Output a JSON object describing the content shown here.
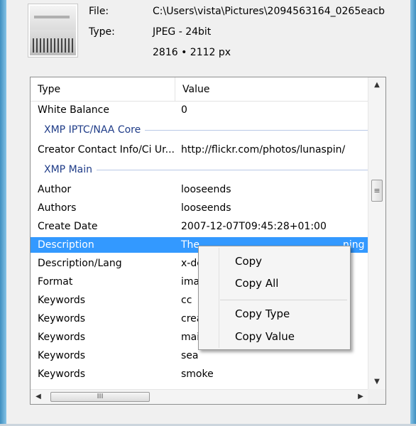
{
  "file_info": {
    "file_label": "File:",
    "file_value": "C:\\Users\\vista\\Pictures\\2094563164_0265eacb",
    "type_label": "Type:",
    "type_value": "JPEG - 24bit",
    "size_value": "2816 • 2112 px"
  },
  "table": {
    "columns": [
      "Type",
      "Value"
    ],
    "rows": [
      {
        "kind": "row",
        "type": "White Balance",
        "value": "0"
      },
      {
        "kind": "group",
        "title": "XMP IPTC/NAA Core"
      },
      {
        "kind": "row",
        "type": "Creator Contact Info/Ci Ur...",
        "value": "http://flickr.com/photos/lunaspin/"
      },
      {
        "kind": "group",
        "title": "XMP Main"
      },
      {
        "kind": "row",
        "type": "Author",
        "value": "looseends"
      },
      {
        "kind": "row",
        "type": "Authors",
        "value": "looseends"
      },
      {
        "kind": "row",
        "type": "Create Date",
        "value": "2007-12-07T09:45:28+01:00"
      },
      {
        "kind": "row",
        "type": "Description",
        "value": "The",
        "value_tail": "ning",
        "selected": true
      },
      {
        "kind": "row",
        "type": "Description/Lang",
        "value": "x-de"
      },
      {
        "kind": "row",
        "type": "Format",
        "value": "imag"
      },
      {
        "kind": "row",
        "type": "Keywords",
        "value": "cc"
      },
      {
        "kind": "row",
        "type": "Keywords",
        "value": "crea"
      },
      {
        "kind": "row",
        "type": "Keywords",
        "value": "mai"
      },
      {
        "kind": "row",
        "type": "Keywords",
        "value": "sea"
      },
      {
        "kind": "row",
        "type": "Keywords",
        "value": "smoke"
      }
    ]
  },
  "context_menu": {
    "items": [
      "Copy",
      "Copy All",
      "Copy Type",
      "Copy Value"
    ]
  },
  "scroll": {
    "up_glyph": "▲",
    "down_glyph": "▼",
    "left_glyph": "◀",
    "right_glyph": "▶",
    "grip_v": "≡",
    "grip_h": "III"
  },
  "colors": {
    "selection": "#3399ff",
    "group_title": "#1f3c88"
  }
}
